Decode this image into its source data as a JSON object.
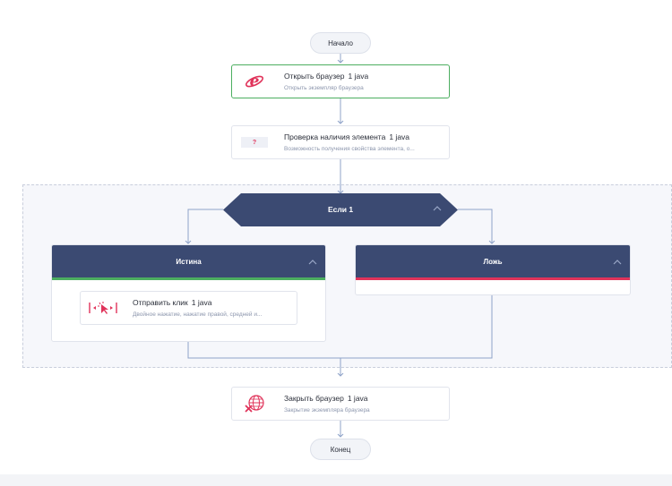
{
  "flow": {
    "start_label": "Начало",
    "end_label": "Конец",
    "open_browser": {
      "title": "Открыть браузер",
      "tag": "1  java",
      "subtitle": "Открыть экземпляр браузера"
    },
    "check_element": {
      "title": "Проверка наличия элемента",
      "tag": "1  java",
      "subtitle": "Возможность получения свойства элемента, о...",
      "icon_text": "?"
    },
    "condition": {
      "label": "Если  1"
    },
    "true_branch": {
      "label": "Истина",
      "color": "#4cae60",
      "send_click": {
        "title": "Отправить клик",
        "tag": "1  java",
        "subtitle": "Двойное нажатие, нажатие правой, средней и..."
      }
    },
    "false_branch": {
      "label": "Ложь",
      "color": "#e0335a"
    },
    "close_browser": {
      "title": "Закрыть браузер",
      "tag": "1  java",
      "subtitle": "Закрытие экземпляра браузера"
    }
  },
  "colors": {
    "header_navy": "#3b4a72",
    "accent_red": "#e0335a",
    "success_green": "#4cae60",
    "connector": "#8fa3c8"
  },
  "icons": {
    "open_browser": "ie-browser-icon",
    "check_element": "question-icon",
    "send_click": "cursor-click-icon",
    "close_browser": "globe-close-icon",
    "collapse": "chevron-up-icon"
  }
}
